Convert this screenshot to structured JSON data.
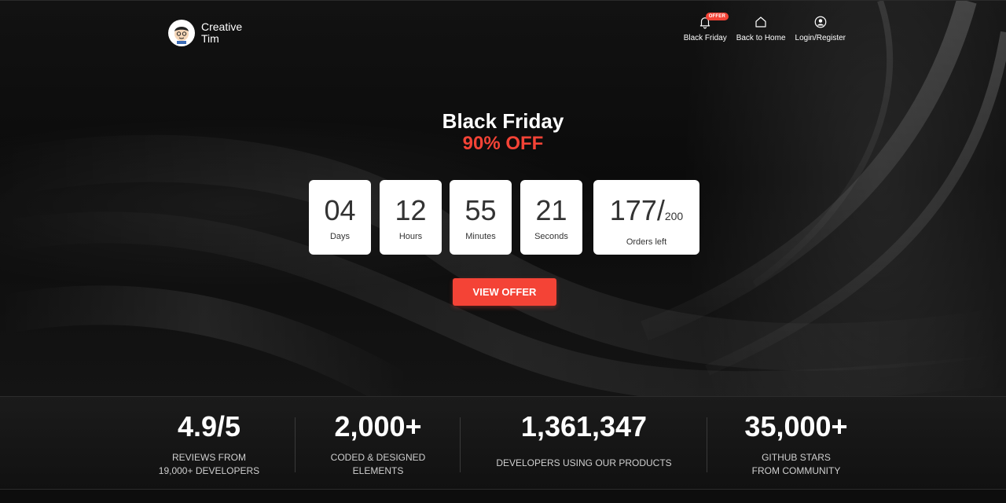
{
  "brand": {
    "name": "Creative Tim"
  },
  "nav": {
    "items": [
      {
        "label": "Black Friday",
        "icon": "bell-icon",
        "badge": "OFFER"
      },
      {
        "label": "Back to Home",
        "icon": "home-icon"
      },
      {
        "label": "Login/Register",
        "icon": "user-circle-icon"
      }
    ]
  },
  "hero": {
    "title": "Black Friday",
    "subtitle": "90% OFF",
    "countdown": [
      {
        "value": "04",
        "label": "Days"
      },
      {
        "value": "12",
        "label": "Hours"
      },
      {
        "value": "55",
        "label": "Minutes"
      },
      {
        "value": "21",
        "label": "Seconds"
      }
    ],
    "orders": {
      "value": "177/",
      "total": "200",
      "label": "Orders left"
    },
    "cta": "VIEW OFFER"
  },
  "stats": [
    {
      "value": "4.9/5",
      "desc_line1": "REVIEWS FROM",
      "desc_line2": "19,000+ DEVELOPERS"
    },
    {
      "value": "2,000+",
      "desc_line1": "CODED & DESIGNED",
      "desc_line2": "ELEMENTS"
    },
    {
      "value": "1,361,347",
      "desc_line1": "DEVELOPERS USING OUR PRODUCTS",
      "desc_line2": ""
    },
    {
      "value": "35,000+",
      "desc_line1": "GITHUB STARS",
      "desc_line2": "FROM COMMUNITY"
    }
  ],
  "colors": {
    "accent": "#f44336",
    "background": "#0a0a0a",
    "tile": "#ffffff"
  }
}
